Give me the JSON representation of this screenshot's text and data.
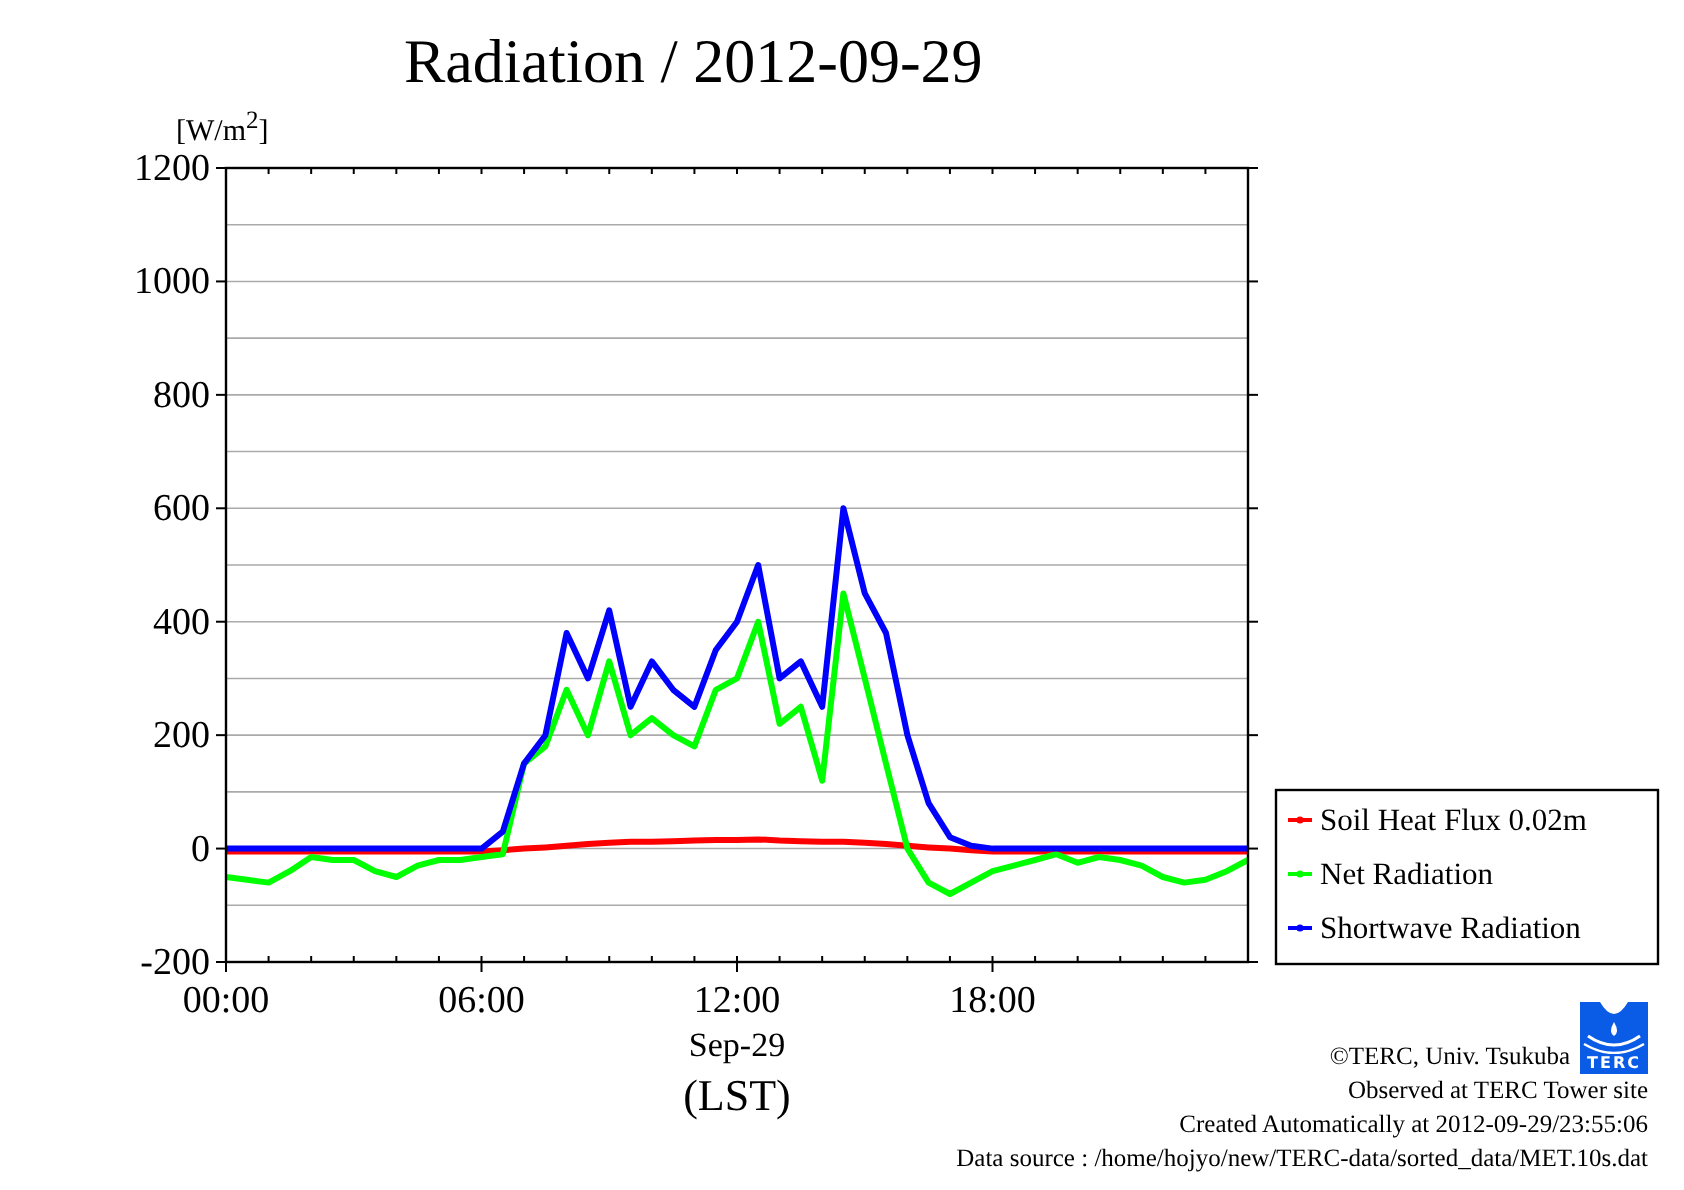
{
  "title": "Radiation / 2012-09-29",
  "chart_data": {
    "type": "line",
    "grid": true,
    "legend": true,
    "ylabel": "[W/m$^{2}$]",
    "xlabel": "Sep-29",
    "xlim": [
      0,
      24
    ],
    "ylim": [
      -200,
      1200
    ],
    "xticks": [
      {
        "value": 0,
        "label": "00:00"
      },
      {
        "value": 6,
        "label": "06:00"
      },
      {
        "value": 12,
        "label": "12:00"
      },
      {
        "value": 18,
        "label": "18:00"
      }
    ],
    "yticks": [
      -200,
      0,
      200,
      400,
      600,
      800,
      1000,
      1200
    ],
    "x": [
      0,
      0.5,
      1,
      1.5,
      2,
      2.5,
      3,
      3.5,
      4,
      4.5,
      5,
      5.5,
      6,
      6.5,
      7,
      7.5,
      8,
      8.5,
      9,
      9.5,
      10,
      10.5,
      11,
      11.5,
      12,
      12.5,
      13,
      13.5,
      14,
      14.5,
      15,
      15.5,
      16,
      16.5,
      17,
      17.5,
      18,
      18.5,
      19,
      19.5,
      20,
      20.5,
      21,
      21.5,
      22,
      22.5,
      23,
      23.5,
      24
    ],
    "series": [
      {
        "name": "Soil Heat Flux 0.02m",
        "color": "#ff0000",
        "values": [
          -5,
          -5,
          -5,
          -5,
          -5,
          -5,
          -5,
          -5,
          -5,
          -5,
          -5,
          -5,
          -5,
          -3,
          0,
          2,
          5,
          8,
          10,
          12,
          12,
          13,
          14,
          15,
          15,
          16,
          14,
          13,
          12,
          12,
          10,
          8,
          5,
          2,
          0,
          -3,
          -5,
          -5,
          -5,
          -5,
          -5,
          -5,
          -5,
          -5,
          -5,
          -5,
          -5,
          -5,
          -5
        ]
      },
      {
        "name": "Net Radiation",
        "color": "#00ff00",
        "values": [
          -50,
          -55,
          -60,
          -40,
          -15,
          -20,
          -20,
          -40,
          -50,
          -30,
          -20,
          -20,
          -15,
          -10,
          150,
          180,
          280,
          200,
          330,
          200,
          230,
          200,
          180,
          280,
          300,
          400,
          220,
          250,
          120,
          450,
          300,
          150,
          0,
          -60,
          -80,
          -60,
          -40,
          -30,
          -20,
          -10,
          -25,
          -15,
          -20,
          -30,
          -50,
          -60,
          -55,
          -40,
          -20
        ]
      },
      {
        "name": "Shortwave Radiation",
        "color": "#0000ff",
        "values": [
          0,
          0,
          0,
          0,
          0,
          0,
          0,
          0,
          0,
          0,
          0,
          0,
          0,
          30,
          150,
          200,
          380,
          300,
          420,
          250,
          330,
          280,
          250,
          350,
          400,
          500,
          300,
          330,
          250,
          600,
          450,
          380,
          200,
          80,
          20,
          5,
          0,
          0,
          0,
          0,
          0,
          0,
          0,
          0,
          0,
          0,
          0,
          0,
          0
        ]
      }
    ]
  },
  "time_zone": "(LST)",
  "logo_text": "TERC",
  "credits": [
    "©TERC, Univ. Tsukuba",
    "Observed at TERC Tower site",
    "Created Automatically at 2012-09-29/23:55:06",
    "Data source : /home/hojyo/new/TERC-data/sorted_data/MET.10s.dat"
  ]
}
